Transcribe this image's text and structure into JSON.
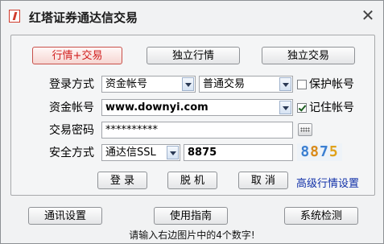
{
  "window": {
    "title": "红塔证券通达信交易",
    "close_symbol": "✕"
  },
  "modes": [
    {
      "label": "行情+交易",
      "active": true
    },
    {
      "label": "独立行情",
      "active": false
    },
    {
      "label": "独立交易",
      "active": false
    }
  ],
  "login_method": {
    "label": "登录方式",
    "account_type": "资金帐号",
    "trade_type": "普通交易"
  },
  "protect_account": {
    "label": "保护帐号",
    "checked": false
  },
  "account": {
    "label": "资金帐号",
    "value": "www.downyi.com"
  },
  "remember_account": {
    "label": "记住帐号",
    "checked": true
  },
  "password": {
    "label": "交易密码",
    "value": "**********"
  },
  "security": {
    "label": "安全方式",
    "method": "通达信SSL",
    "code_value": "8875"
  },
  "captcha": {
    "digits": [
      "8",
      "8",
      "7",
      "5"
    ],
    "colors": [
      "#3b7fd1",
      "#d98a1a",
      "#3b7fd1",
      "#e0a21c"
    ]
  },
  "actions": {
    "login": "登 录",
    "offline": "脱 机",
    "cancel": "取 消",
    "advanced": "高级行情设置"
  },
  "footer": {
    "comm_settings": "通讯设置",
    "guide": "使用指南",
    "system_check": "系统检测"
  },
  "status_text": "请输入右边图片中的4个数字!"
}
